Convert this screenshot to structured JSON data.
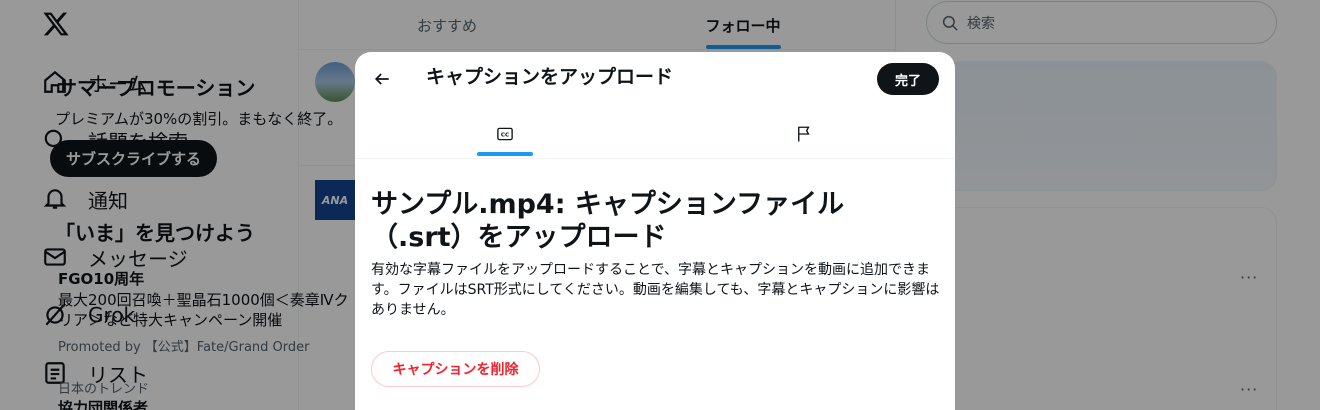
{
  "nav": {
    "logo": "x-logo-icon",
    "items": [
      {
        "label": "ホーム",
        "icon": "home-icon"
      },
      {
        "label": "話題を検索",
        "icon": "search-icon"
      },
      {
        "label": "通知",
        "icon": "bell-icon"
      },
      {
        "label": "メッセージ",
        "icon": "mail-icon"
      },
      {
        "label": "Grok",
        "icon": "grok-icon"
      },
      {
        "label": "リスト",
        "icon": "list-icon"
      }
    ]
  },
  "timeline": {
    "tabs": [
      {
        "label": "おすすめ",
        "selected": false
      },
      {
        "label": "フォロー中",
        "selected": true
      }
    ],
    "avatar2_text": "ANA"
  },
  "sidebar": {
    "search_placeholder": "検索",
    "promo": {
      "title": "サマープロモーション",
      "text": "プレミアムが30%の割引。まもなく終了。",
      "button": "サブスクライブする"
    },
    "trends": {
      "heading": "「いま」を見つけよう",
      "item1": {
        "name": "FGO10周年",
        "desc": "最大200回召喚＋聖晶石1000個＜奏章Ⅳクリア＞など特大キャンペーン開催",
        "promoted": "Promoted by 【公式】Fate/Grand Order",
        "more": "···"
      },
      "item2": {
        "context": "日本のトレンド",
        "name": "協力団関係者",
        "more": "···"
      }
    }
  },
  "modal": {
    "title": "キャプションをアップロード",
    "done_label": "完了",
    "tabs": [
      {
        "icon": "cc-icon",
        "selected": true
      },
      {
        "icon": "flag-icon",
        "selected": false
      }
    ],
    "file_title": "サンプル.mp4: キャプションファイル（.srt）をアップロード",
    "description": "有効な字幕ファイルをアップロードすることで、字幕とキャプションを動画に追加できます。ファイルはSRT形式にしてください。動画を編集しても、字幕とキャプションに影響はありません。",
    "delete_label": "キャプションを削除"
  },
  "colors": {
    "accent": "#1d9bf0",
    "danger": "#f4212e",
    "text": "#0f1419",
    "muted": "#536471"
  }
}
